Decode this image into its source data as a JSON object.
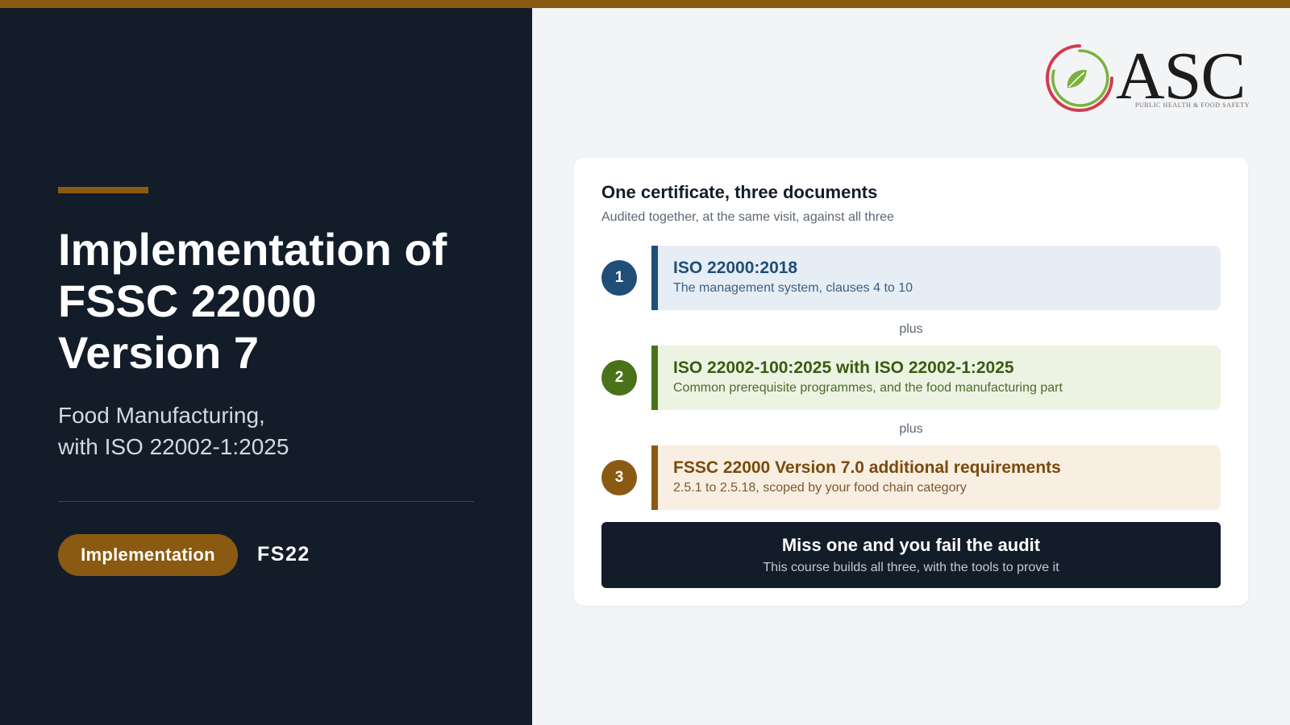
{
  "colors": {
    "accent": "#8b5a12",
    "navy": "#131c29",
    "step1": "#1f4e79",
    "step2": "#4a7319",
    "step3": "#8b5a12",
    "step1_bg": "#e6edf5",
    "step2_bg": "#edf3e3",
    "step3_bg": "#f8eee1",
    "logo_red": "#d43a4e",
    "logo_green": "#7ab23c"
  },
  "hero": {
    "title_lines": [
      "Implementation of",
      "FSSC 22000",
      "Version 7"
    ],
    "subtitle_lines": [
      "Food Manufacturing,",
      "with ISO 22002-1:2025"
    ],
    "badge": "Implementation",
    "code": "FS22"
  },
  "logo": {
    "text": "ASC",
    "tagline": "PUBLIC HEALTH & FOOD SAFETY",
    "icon": "leaf-circle-icon"
  },
  "card": {
    "title": "One certificate, three documents",
    "subtitle": "Audited together, at the same visit, against all three",
    "separator": "plus",
    "steps": [
      {
        "number": "1",
        "title": "ISO 22000:2018",
        "description": "The management system, clauses 4 to 10"
      },
      {
        "number": "2",
        "title": "ISO 22002-100:2025 with ISO 22002-1:2025",
        "description": "Common prerequisite programmes, and the food manufacturing part"
      },
      {
        "number": "3",
        "title": "FSSC 22000 Version 7.0 additional requirements",
        "description": "2.5.1 to 2.5.18, scoped by your food chain category"
      }
    ],
    "alert": {
      "title": "Miss one and you fail the audit",
      "subtitle": "This course builds all three, with the tools to prove it"
    }
  }
}
